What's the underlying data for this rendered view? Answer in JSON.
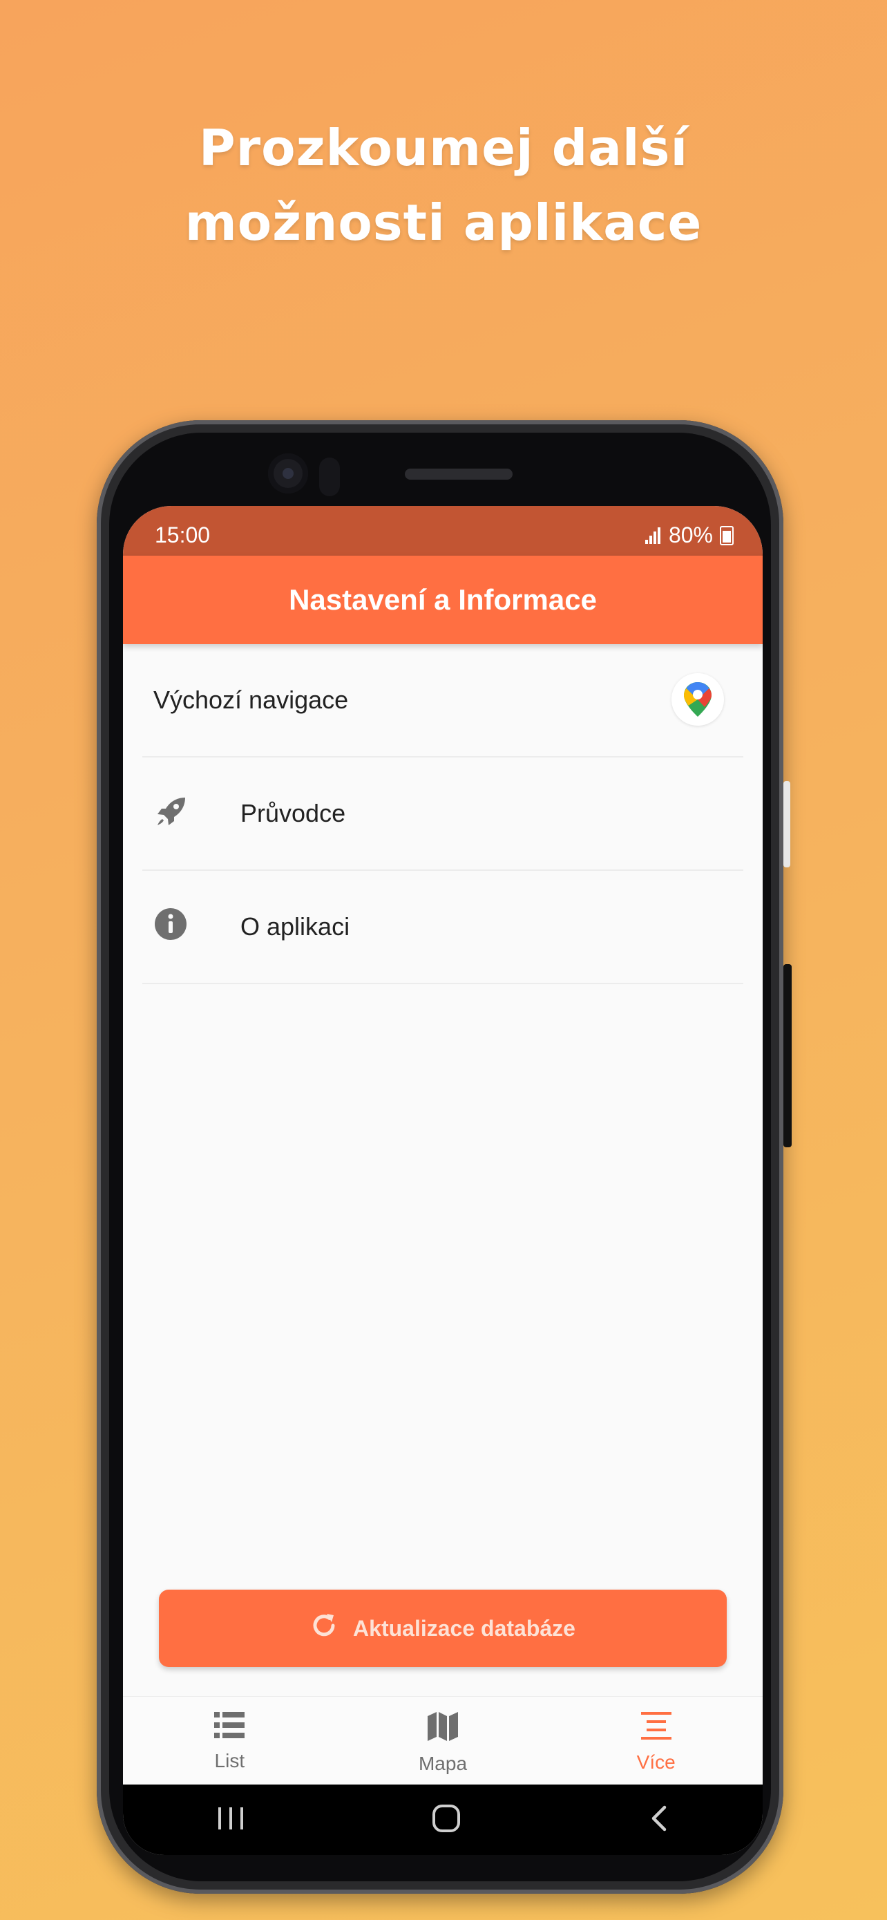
{
  "promo": {
    "line1": "Prozkoumej další",
    "line2": "možnosti aplikace"
  },
  "status_bar": {
    "time": "15:00",
    "battery": "80%"
  },
  "app_bar": {
    "title": "Nastavení a Informace"
  },
  "settings": {
    "items": [
      {
        "label": "Výchozí navigace",
        "icon": "google-maps-icon"
      },
      {
        "label": "Průvodce",
        "icon": "rocket-icon"
      },
      {
        "label": "O aplikaci",
        "icon": "info-icon"
      }
    ]
  },
  "update_button": {
    "label": "Aktualizace databáze",
    "icon": "refresh-icon"
  },
  "bottom_nav": {
    "items": [
      {
        "label": "List",
        "icon": "list-icon"
      },
      {
        "label": "Mapa",
        "icon": "map-icon"
      },
      {
        "label": "Více",
        "icon": "more-icon",
        "active": true
      }
    ]
  },
  "colors": {
    "accent": "#ff6f42",
    "status_bar": "#c25533",
    "background_gradient_start": "#f7a45c",
    "background_gradient_end": "#f7c15c"
  }
}
